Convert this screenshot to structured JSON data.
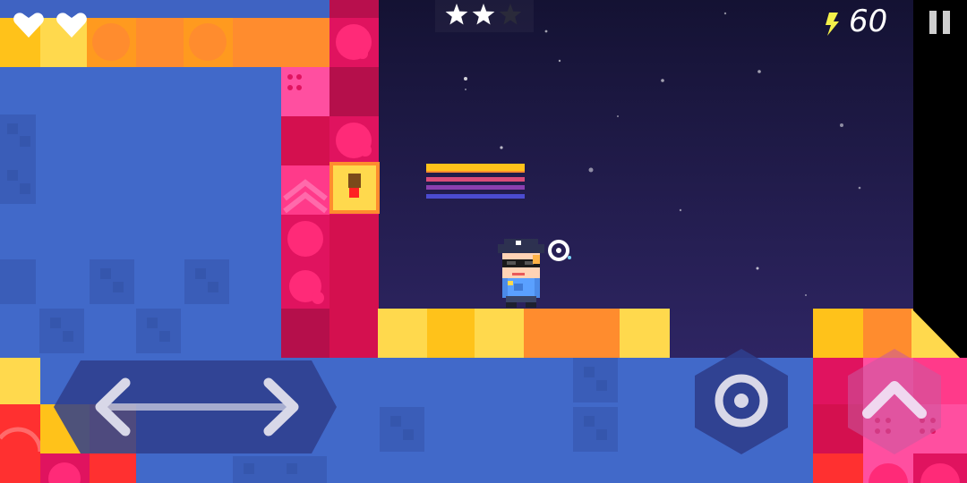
{
  "hud": {
    "lives": 2,
    "stars_total": 3,
    "stars_earned": 2,
    "bolt_count": "60",
    "icons": {
      "life": "heart-icon",
      "star": "star-icon",
      "currency": "lightning-bolt-icon",
      "pause": "pause-icon"
    }
  },
  "controls": {
    "move": "left-right-arrows-icon",
    "action": "target-ring-icon",
    "jump": "chevron-up-icon"
  },
  "colors": {
    "wall_blue": "#4169c9",
    "sky_top": "#141233",
    "sky_bottom": "#2e2563",
    "yellow": "#ffd94d",
    "orange": "#ff8c2e",
    "magenta": "#e0135f",
    "pink": "#ff4fa0",
    "red": "#ff3030"
  }
}
